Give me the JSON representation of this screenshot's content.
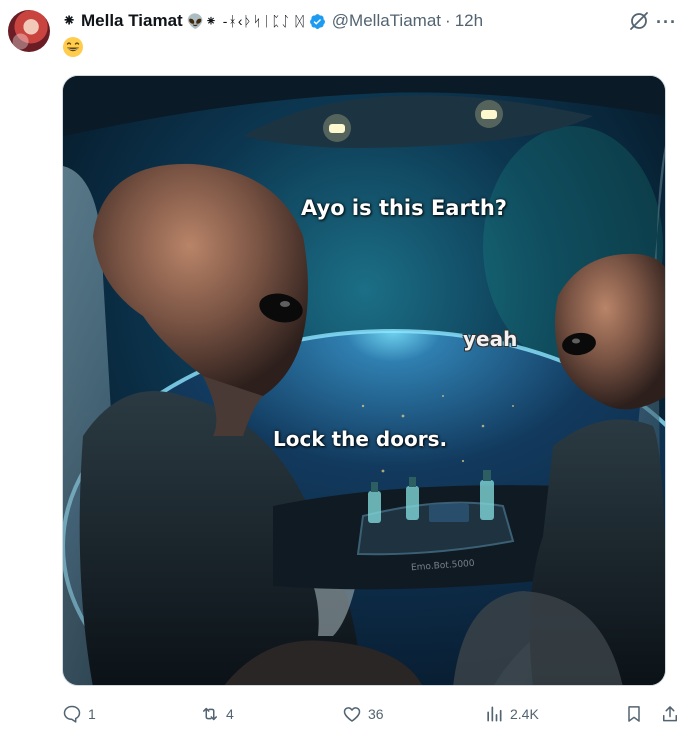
{
  "tweet": {
    "author_name": "Mella Tiamat",
    "name_prefix_glyph": "⁕",
    "name_suffix_glyphs": "👽⁕ -ᚼ‹ᚦᛋ͏ᛁᛈᛇ ᛞ",
    "handle": "@MellaTiamat",
    "separator": "·",
    "time": "12h",
    "text_emoji": "😄"
  },
  "image": {
    "caption_top": "Ayo is this Earth?",
    "caption_right": "yeah",
    "caption_bottom": "Lock the doors.",
    "watermark": "Emo.Bot.5000"
  },
  "actions": {
    "replies": "1",
    "retweets": "4",
    "likes": "36",
    "views": "2.4K"
  },
  "colors": {
    "text_primary": "#0f1419",
    "text_secondary": "#536471",
    "verified": "#1d9bf0"
  }
}
